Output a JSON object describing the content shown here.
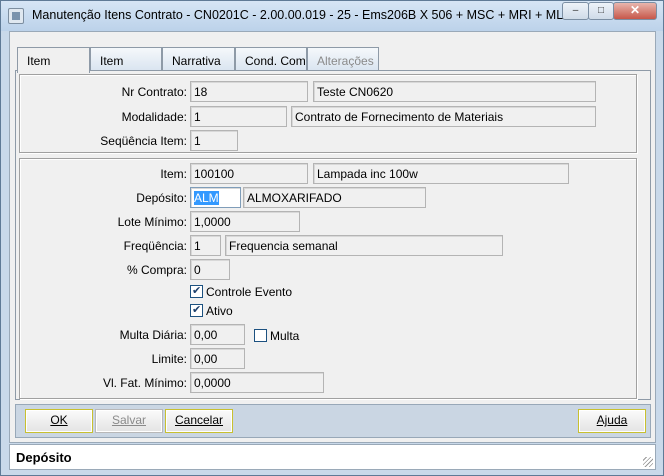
{
  "window": {
    "title": "Manutenção Itens Contrato - CN0201C - 2.00.00.019 - 25 - Ems206B X 506 + MSC + MRI + MLF ...",
    "controls": {
      "minimize": "–",
      "maximize": "□",
      "close": "✕"
    }
  },
  "tabs": [
    {
      "label": "Item",
      "active": true,
      "enabled": true
    },
    {
      "label": "Item",
      "active": false,
      "enabled": true
    },
    {
      "label": "Narrativa",
      "active": false,
      "enabled": true
    },
    {
      "label": "Cond. Com",
      "active": false,
      "enabled": true
    },
    {
      "label": "Alterações",
      "active": false,
      "enabled": false
    }
  ],
  "header": {
    "nr_contrato": {
      "label": "Nr Contrato:",
      "code": "18",
      "description": "Teste CN0620"
    },
    "modalidade": {
      "label": "Modalidade:",
      "code": "1",
      "description": "Contrato de Fornecimento de Materiais"
    },
    "sequencia": {
      "label": "Seqüência Item:",
      "value": "1"
    }
  },
  "details": {
    "item": {
      "label": "Item:",
      "code": "100100",
      "description": "Lampada inc 100w"
    },
    "deposito": {
      "label": "Depósito:",
      "code": "ALM",
      "description": "ALMOXARIFADO"
    },
    "lote_minimo": {
      "label": "Lote Mínimo:",
      "value": "1,0000"
    },
    "frequencia": {
      "label": "Freqüência:",
      "code": "1",
      "description": "Frequencia semanal"
    },
    "pct_compra": {
      "label": "% Compra:",
      "value": "0"
    },
    "controle_evento": {
      "label": "Controle Evento",
      "checked": true
    },
    "ativo": {
      "label": "Ativo",
      "checked": true
    },
    "multa_diaria": {
      "label": "Multa Diária:",
      "value": "0,00"
    },
    "multa": {
      "label": "Multa",
      "checked": false
    },
    "limite": {
      "label": "Limite:",
      "value": "0,00"
    },
    "vl_fat_minimo": {
      "label": "Vl. Fat. Mínimo:",
      "value": "0,0000"
    }
  },
  "buttons": {
    "ok": {
      "label": "OK",
      "enabled": true
    },
    "salvar": {
      "label": "Salvar",
      "enabled": false
    },
    "cancelar": {
      "label": "Cancelar",
      "enabled": true
    },
    "ajuda": {
      "label": "Ajuda",
      "enabled": true
    }
  },
  "status": {
    "text": "Depósito"
  }
}
